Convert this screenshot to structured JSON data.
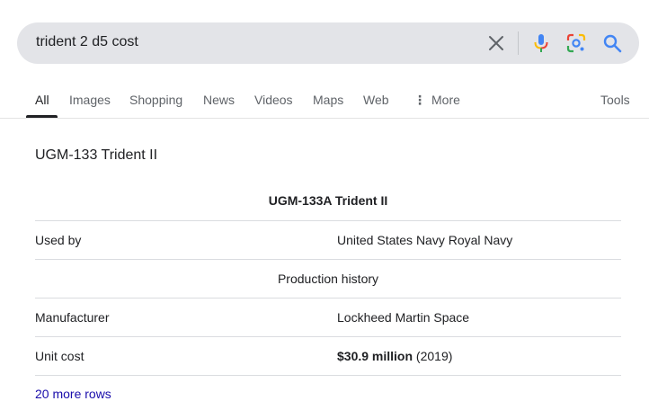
{
  "search": {
    "query": "trident 2 d5 cost",
    "icons": {
      "clear": "close-icon",
      "voice": "microphone-icon",
      "lens": "camera-lens-icon",
      "search": "magnifier-icon"
    }
  },
  "tabs": {
    "items": [
      {
        "label": "All",
        "active": true
      },
      {
        "label": "Images"
      },
      {
        "label": "Shopping"
      },
      {
        "label": "News"
      },
      {
        "label": "Videos"
      },
      {
        "label": "Maps"
      },
      {
        "label": "Web"
      },
      {
        "label": "More"
      }
    ],
    "tools_label": "Tools"
  },
  "result": {
    "title": "UGM-133 Trident II",
    "infobox": {
      "caption": "UGM-133A Trident II",
      "used_by": {
        "key": "Used by",
        "value": "United States Navy Royal Navy"
      },
      "section": "Production history",
      "manufacturer": {
        "key": "Manufacturer",
        "value": "Lockheed Martin Space"
      },
      "unit_cost": {
        "key": "Unit cost",
        "value_bold": "$30.9 million",
        "value_rest": " (2019)"
      }
    },
    "more_rows": "20 more rows"
  },
  "colors": {
    "search_bg": "#e3e4e8",
    "link": "#1a0dab",
    "google_blue": "#4285f4",
    "google_red": "#ea4335",
    "google_yellow": "#fbbc04",
    "google_green": "#34a853"
  }
}
